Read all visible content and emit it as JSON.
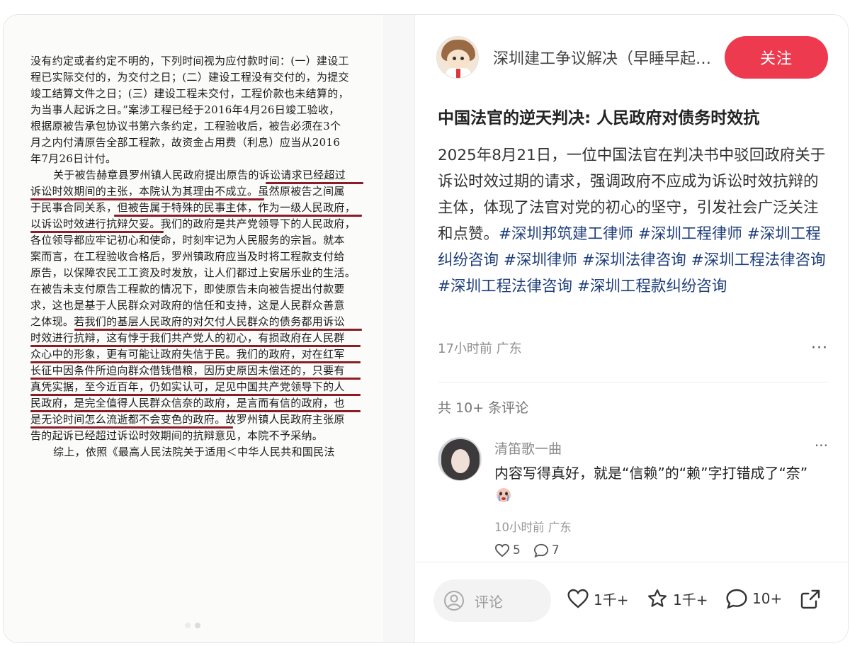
{
  "document": {
    "lines": [
      {
        "text": "没有约定或者约定不明的，下列时间视为应付款时间：(一）建设工",
        "indent": false
      },
      {
        "text": "程已实际交付的，为交付之日；(二）建设工程没有交付的，为提交",
        "indent": false
      },
      {
        "text": "竣工结算文件之日；(三）建设工程未交付，工程价款也未结算的，",
        "indent": false
      },
      {
        "text": "为当事人起诉之日。”案涉工程已经于2016年4月26日竣工验收，",
        "indent": false
      },
      {
        "text": "根据原被告承包协议书第六条约定，工程验收后，被告必须在3个",
        "indent": false
      },
      {
        "text": "月之内付清原告全部工程款，故资金占用费（利息）应当从2016",
        "indent": false
      },
      {
        "text": "年7月26日计付。",
        "indent": false
      },
      {
        "text": "关于被告赫章县罗州镇人民政府提出原告的诉讼请求已经超过",
        "indent": true
      },
      {
        "text": "诉讼时效期间的主张，本院认为其理由不成立。虽然原被告之间属",
        "indent": false
      },
      {
        "text": "于民事合同关系，但被告属于特殊的民事主体，作为一级人民政府，",
        "indent": false
      },
      {
        "text": "以诉讼时效进行抗辩欠妥。我们的政府是共产党领导下的人民政府，",
        "indent": false
      },
      {
        "text": "各位领导都应牢记初心和使命，时刻牢记为人民服务的宗旨。就本",
        "indent": false
      },
      {
        "text": "案而言，在工程验收合格后，罗州镇政府应当及时将工程款支付给",
        "indent": false
      },
      {
        "text": "原告，以保障农民工工资及时发放，让人们都过上安居乐业的生活。",
        "indent": false
      },
      {
        "text": "在被告未支付原告工程款的情况下，即使原告未向被告提出付款要",
        "indent": false
      },
      {
        "text": "求，这也是基于人民群众对政府的信任和支持，这是人民群众善意",
        "indent": false
      },
      {
        "text": "之体现。若我们的基层人民政府的对欠付人民群众的债务都用诉讼",
        "indent": false
      },
      {
        "text": "时效进行抗辩，这有悖于我们共产党人的初心，有损政府在人民群",
        "indent": false
      },
      {
        "text": "众心中的形象，更有可能让政府失信于民。我们的政府，对在红军",
        "indent": false
      },
      {
        "text": "长征中因条件所迫向群众借钱借粮，因历史原因未偿还的，只要有",
        "indent": false
      },
      {
        "text": "真凭实据，至今近百年，仍如实认可，足见中国共产党领导下的人",
        "indent": false
      },
      {
        "text": "民政府，是完全值得人民群众信奈的政府，是言而有信的政府，也",
        "indent": false
      },
      {
        "text": "是无论时间怎么流逝都不会变色的政府。故罗州镇人民政府主张原",
        "indent": false
      },
      {
        "text": "告的起诉已经超过诉讼时效期间的抗辩意见，本院不予采纳。",
        "indent": false
      },
      {
        "text": "综上，依照《最高人民法院关于适用＜中华人民共和国民法",
        "indent": true
      }
    ]
  },
  "author": {
    "name": "深圳建工争议解决（早睡早起版）",
    "follow_label": "关注"
  },
  "post": {
    "title": "中国法官的逆天判决: 人民政府对债务时效抗",
    "body_text": "2025年8月21日，一位中国法官在判决书中驳回政府关于诉讼时效过期的请求，强调政府不应成为诉讼时效抗辩的主体，体现了法官对党的初心的坚守，引发社会广泛关注和点赞。",
    "tags": [
      "#深圳邦筑建工律师",
      "#深圳工程律师",
      "#深圳工程纠纷咨询",
      "#深圳律师",
      "#深圳法律咨询",
      "#深圳工程法律咨询",
      "#深圳工程法律咨询",
      "#深圳工程款纠纷咨询"
    ],
    "meta": "17小时前 广东"
  },
  "comments": {
    "count_label": "共 10+ 条评论",
    "items": [
      {
        "user": "清笛歌一曲",
        "text": "内容写得真好，就是“信赖”的“赖”字打错成了“奈”",
        "meta": "10小时前 广东",
        "likes": "5",
        "replies": "7"
      }
    ]
  },
  "bottom_bar": {
    "comment_placeholder": "评论",
    "likes": "1千+",
    "favorites": "1千+",
    "comments": "10+"
  },
  "colors": {
    "follow_button": "#ee3a4f",
    "tag": "#1f3f7a",
    "underline": "#8a1d25"
  }
}
